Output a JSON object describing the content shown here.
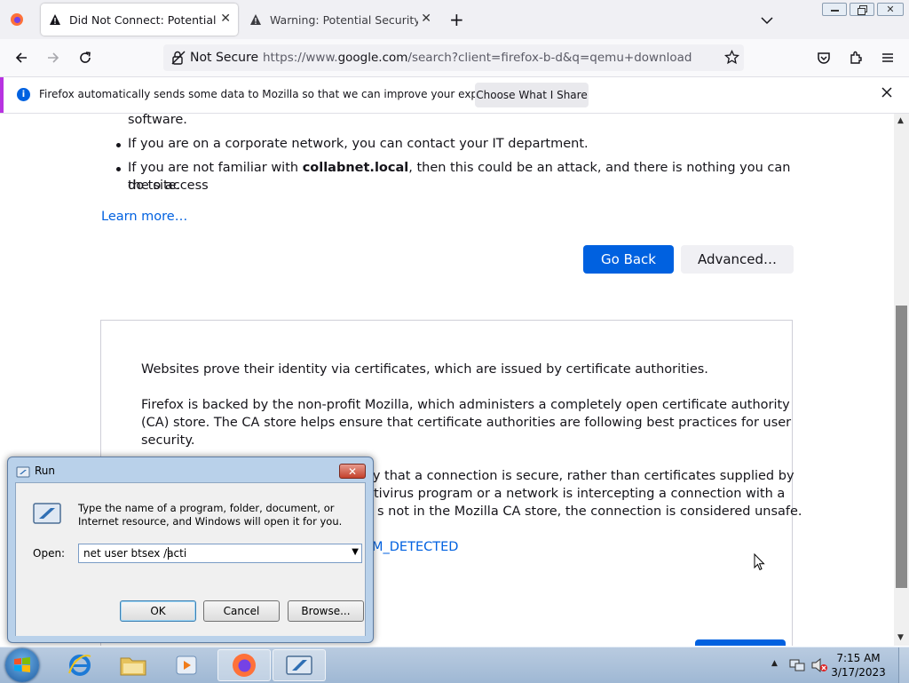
{
  "browser": {
    "tabs": [
      {
        "title": "Did Not Connect: Potential Security Issue",
        "active": true
      },
      {
        "title": "Warning: Potential Security Risk Ahead",
        "active": false
      }
    ],
    "new_tab_symbol": "+",
    "security_label": "Not Secure",
    "url_prefix": "https://www.",
    "url_domain": "google.com",
    "url_rest": "/search?client=firefox-b-d&q=qemu+download"
  },
  "notification": {
    "message": "Firefox automatically sends some data to Mozilla so that we can improve your experience.",
    "button": "Choose What I Share"
  },
  "page": {
    "partial_line": "software.",
    "bullet2": "If you are on a corporate network, you can contact your IT department.",
    "bullet3_pre": "If you are not familiar with ",
    "bullet3_bold": "collabnet.local",
    "bullet3_post": ", then this could be an attack, and there is nothing you can do to access",
    "bullet3_line2": "the site.",
    "learn_more": "Learn more…",
    "go_back": "Go Back",
    "advanced": "Advanced…",
    "adv_p1": "Websites prove their identity via certificates, which are issued by certificate authorities.",
    "adv_p2_l1": "Firefox is backed by the non-profit Mozilla, which administers a completely open certificate authority",
    "adv_p2_l2": "(CA) store. The CA store helps ensure that certificate authorities are following best practices for user",
    "adv_p2_l3": "security.",
    "adv_p3_l1": "fy that a connection is secure, rather than certificates supplied by",
    "adv_p3_l2": "tivirus program or a network is intercepting a connection with a",
    "adv_p3_l3": "s not in the Mozilla CA store, the connection is considered unsafe.",
    "error_code_partial": "M_DETECTED"
  },
  "run_dialog": {
    "title": "Run",
    "description": "Type the name of a program, folder, document, or Internet resource, and Windows will open it for you.",
    "open_label": "Open:",
    "open_value": "net user btsex /acti",
    "ok": "OK",
    "cancel": "Cancel",
    "browse": "Browse..."
  },
  "taskbar": {
    "time": "7:15 AM",
    "date": "3/17/2023"
  },
  "colors": {
    "accent": "#0061e0",
    "notification_stripe": "#b833e1"
  }
}
